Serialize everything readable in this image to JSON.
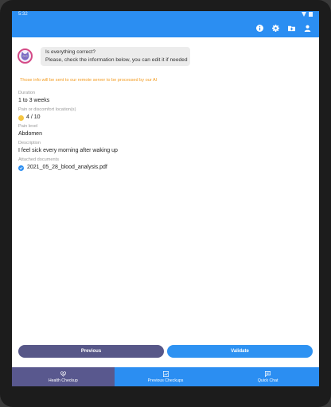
{
  "status_bar": {
    "time": "5:32"
  },
  "colors": {
    "accent": "#2b8ef2",
    "secondary": "#575788",
    "notice": "#f39a1d"
  },
  "chat": {
    "line1": "Is everything correct?",
    "line2": "Please, check the information below, you can edit it if needed"
  },
  "notice": "Those info will be sent to our remote server to be processed by our AI",
  "fields": {
    "duration": {
      "label": "Duration",
      "value": "1 to 3 weeks"
    },
    "pain": {
      "label": "Pain or discomfort location(s)",
      "value": "4 / 10",
      "icon": "neutral-face-icon"
    },
    "pain_level": {
      "label": "Pain level",
      "value": "Abdomen"
    },
    "description": {
      "label": "Description",
      "value": "I feel sick every morning after waking up"
    },
    "documents": {
      "label": "Attached documents",
      "items": [
        "2021_05_28_blood_analysis.pdf"
      ]
    }
  },
  "buttons": {
    "previous": "Previous",
    "validate": "Validate"
  },
  "bottom_nav": [
    {
      "label": "Health Checkup",
      "icon": "heart-pulse-icon",
      "active": true
    },
    {
      "label": "Previous Checkups",
      "icon": "chart-icon",
      "active": false
    },
    {
      "label": "Quick Chat",
      "icon": "chat-icon",
      "active": false
    }
  ],
  "toolbar_icons": [
    "info-icon",
    "settings-icon",
    "folder-add-icon",
    "account-icon"
  ]
}
